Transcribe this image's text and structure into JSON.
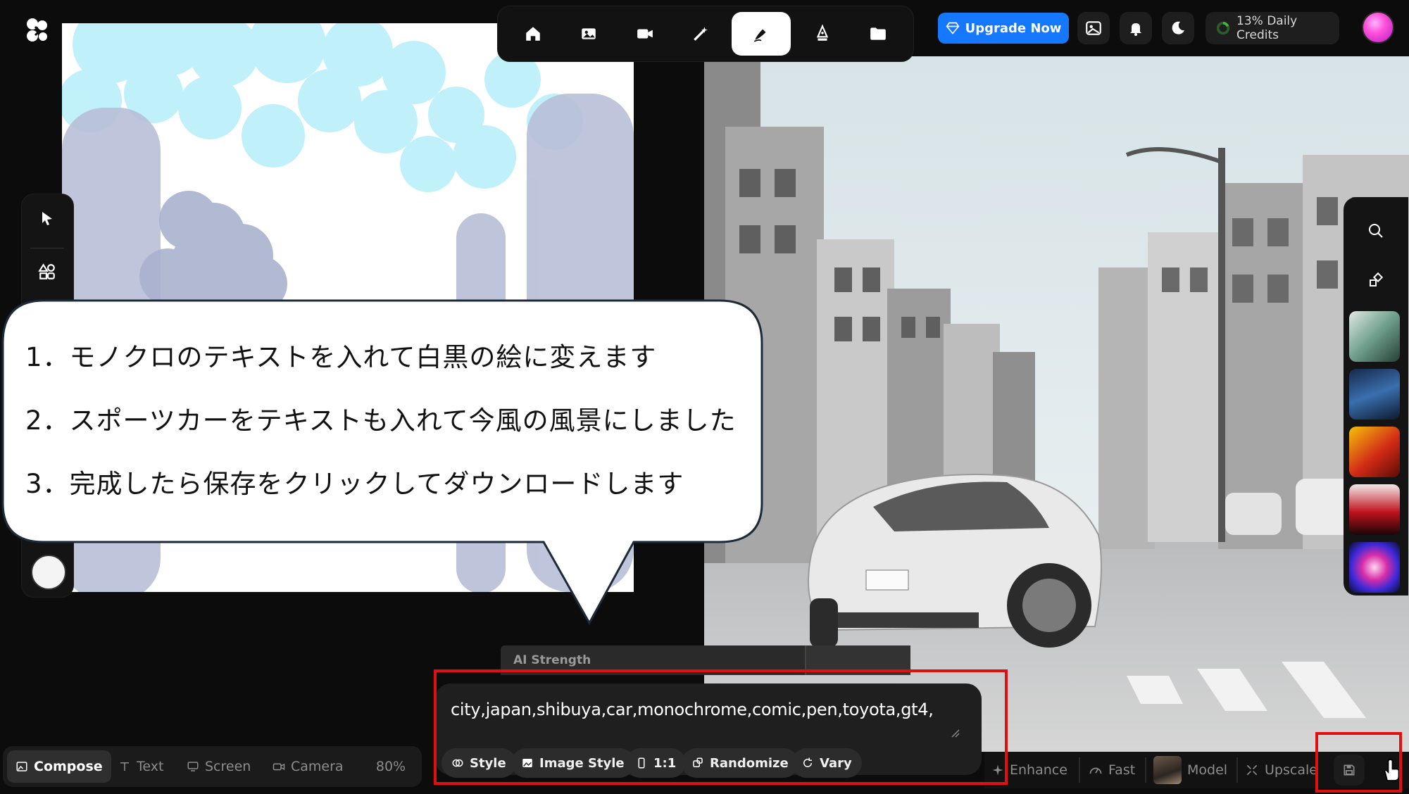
{
  "logo": {
    "icon": "app-logo-icon"
  },
  "top_nav": {
    "items": [
      {
        "name": "home",
        "icon": "home-icon"
      },
      {
        "name": "image",
        "icon": "image-icon"
      },
      {
        "name": "video",
        "icon": "video-icon"
      },
      {
        "name": "enhance",
        "icon": "magic-wand-icon"
      },
      {
        "name": "draw",
        "icon": "pen-icon",
        "active": true
      },
      {
        "name": "vector",
        "icon": "pen-nib-icon"
      },
      {
        "name": "assets",
        "icon": "folder-icon"
      }
    ]
  },
  "header": {
    "upgrade_label": "Upgrade Now",
    "credits_label": "13% Daily Credits",
    "accent_color": "#1677ff"
  },
  "callout": {
    "lines": [
      "1．モノクロのテキストを入れて白黒の絵に変えます",
      "2．スポーツカーをテキストも入れて今風の風景にしました",
      "3．完成したら保存をクリックしてダウンロードします"
    ]
  },
  "ai_strength": {
    "label": "AI Strength"
  },
  "prompt": {
    "text": "city,japan,shibuya,car,monochrome,comic,pen,toyota,gt4,",
    "chips": {
      "style": "Style",
      "image_style": "Image Style",
      "ratio": "1:1",
      "randomize": "Randomize",
      "vary": "Vary"
    }
  },
  "bottom_left": {
    "compose": "Compose",
    "text": "Text",
    "screen": "Screen",
    "camera": "Camera",
    "zoom": "80%"
  },
  "bottom_right": {
    "enhance": "Enhance",
    "fast": "Fast",
    "model": "Model",
    "upscale": "Upscale"
  },
  "annotation_color": "#e01010"
}
